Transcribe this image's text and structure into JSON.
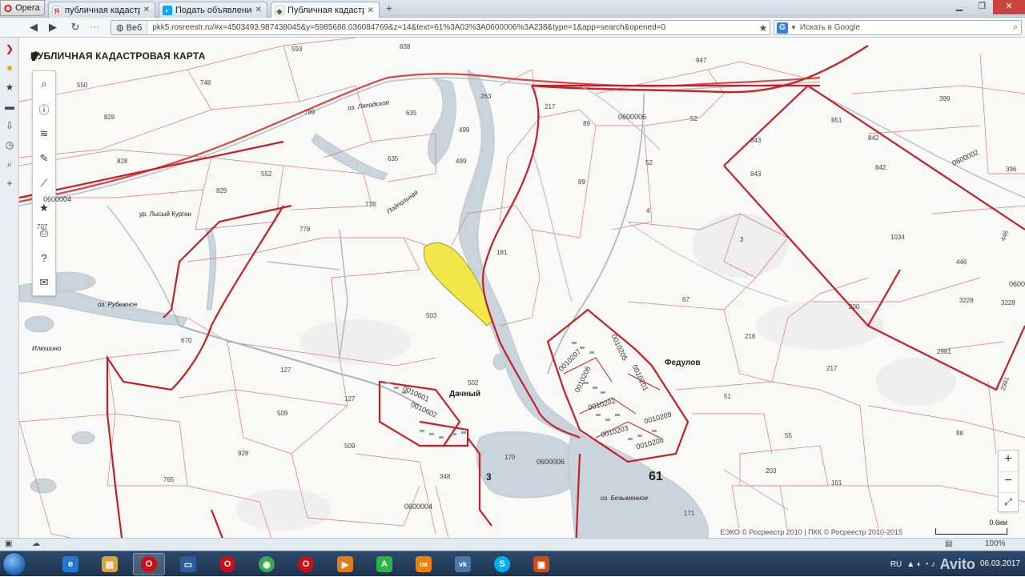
{
  "browser": {
    "menu_label": "Opera",
    "tabs": [
      {
        "label": "публичная кадастров...",
        "favicon": "yandex-icon",
        "active": false
      },
      {
        "label": "Подать объявление —...",
        "favicon": "avito-icon",
        "active": false
      },
      {
        "label": "Публичная кадастров...",
        "favicon": "map-icon",
        "active": true
      }
    ],
    "address": {
      "badge": "Веб",
      "url": "pkk5.rosreestr.ru/#x=4503493.987438045&y=5985686.036084769&z=14&text=61%3A03%3A0600006%3A238&type=1&app=search&opened=0"
    },
    "search": {
      "engine": "G",
      "placeholder": "Искать в Google"
    }
  },
  "map": {
    "title": "ПУБЛИЧНАЯ КАДАСТРОВАЯ КАРТА",
    "toolbar": [
      {
        "name": "search",
        "icon": "search-icon"
      },
      {
        "name": "info",
        "icon": "info-icon"
      },
      {
        "name": "layers",
        "icon": "layers-icon"
      },
      {
        "name": "draw",
        "icon": "pencil-icon"
      },
      {
        "name": "measure",
        "icon": "ruler-icon"
      },
      {
        "name": "favorites",
        "icon": "star-icon"
      },
      {
        "name": "print",
        "icon": "printer-icon"
      },
      {
        "name": "help",
        "icon": "help-icon"
      },
      {
        "name": "mail",
        "icon": "mail-icon"
      }
    ],
    "zoom_in": "+",
    "zoom_out": "−",
    "attribution": "ЕЭКО © Росреестр 2010 | ПКК © Росреестр 2010-2015",
    "scale": "0.6км",
    "labels": {
      "l593": "593",
      "l550": "550",
      "l748": "748",
      "l828a": "828",
      "l828b": "828",
      "l789": "789",
      "l838": "838",
      "l635a": "635",
      "l635b": "635",
      "l263": "263",
      "l499a": "499",
      "l499b": "499",
      "l217": "217",
      "l947": "947",
      "l52a": "52",
      "l52b": "52",
      "l89a": "89",
      "l89b": "89",
      "l0600006a": "0600006",
      "l552": "552",
      "l829": "829",
      "l778a": "778",
      "l778b": "778",
      "l0600004a": "0600004",
      "l707": "707",
      "l181": "181",
      "l503": "503",
      "l502": "502",
      "l670": "670",
      "l127a": "127",
      "l127b": "127",
      "l509a": "509",
      "l509b": "509",
      "l928": "928",
      "l765": "765",
      "l348": "348",
      "l0600004b": "0600004",
      "l170": "170",
      "l0600006b": "0600006",
      "l3a": "3",
      "l171": "171",
      "l61": "61",
      "l4": "4",
      "l3b": "3",
      "l67": "67",
      "l216": "216",
      "l217b": "217",
      "l51": "51",
      "l55": "55",
      "l203": "203",
      "l101": "101",
      "l88": "88",
      "l851": "851",
      "l843a": "843",
      "l843b": "843",
      "l842a": "842",
      "l842b": "842",
      "l1034": "1034",
      "l446a": "446",
      "l446b": "446",
      "l200": "200",
      "l3228a": "3228",
      "l3228b": "3228",
      "l2981": "2981",
      "l2981b": "2981",
      "l399": "399",
      "l396": "396",
      "l0600002": "0600002",
      "l0600b": "0600",
      "l0010207": "0010207",
      "l0010205": "0010205",
      "l0010206": "0010206",
      "l0010201": "0010201",
      "l0010202": "0010202",
      "l0010209": "0010209",
      "l0010203": "0010203",
      "l0010208": "0010208",
      "l0010601": "0010601",
      "l0010602": "0010602"
    },
    "places": {
      "lysy": "ур. Лысый Курган",
      "rubezhnoe": "оз. Рубежное",
      "ilyushino": "Илюшино",
      "dachny": "Дачный",
      "fedulov": "Федулов",
      "pogodnaya": "Подпольная",
      "ozero_top": "оз. Ляпадское",
      "lake_bottom": "оз. Безымянное"
    }
  },
  "statusbar": {
    "zoom": "100%"
  },
  "taskbar": {
    "apps": [
      {
        "name": "ie",
        "icon": "ie-icon",
        "color": "#1f78d1",
        "glyph": "e"
      },
      {
        "name": "explorer",
        "icon": "folder-icon",
        "color": "#d9a53b",
        "glyph": "▤"
      },
      {
        "name": "opera",
        "icon": "opera-icon",
        "color": "#cc0f16",
        "glyph": "O"
      },
      {
        "name": "monitor",
        "icon": "monitor-icon",
        "color": "#2a5d9c",
        "glyph": "▭"
      },
      {
        "name": "opera2",
        "icon": "opera-icon",
        "color": "#cc0f16",
        "glyph": "O"
      },
      {
        "name": "chrome",
        "icon": "chrome-icon",
        "color": "#3aa757",
        "glyph": "◉"
      },
      {
        "name": "opera3",
        "icon": "opera-icon",
        "color": "#cc0f16",
        "glyph": "O"
      },
      {
        "name": "media",
        "icon": "media-icon",
        "color": "#e27c1a",
        "glyph": "▶"
      },
      {
        "name": "atlas",
        "icon": "a-icon",
        "color": "#2db34a",
        "glyph": "A"
      },
      {
        "name": "ok",
        "icon": "odnoklassniki-icon",
        "color": "#ee8208",
        "glyph": "ок"
      },
      {
        "name": "vk",
        "icon": "vk-icon",
        "color": "#4a76a8",
        "glyph": "vk"
      },
      {
        "name": "skype",
        "icon": "skype-icon",
        "color": "#00aff0",
        "glyph": "S"
      },
      {
        "name": "app",
        "icon": "app-icon",
        "color": "#c94d1c",
        "glyph": "▣"
      }
    ],
    "lang": "RU",
    "time": "",
    "date": "06.03.2017",
    "watermark": "Avito"
  }
}
